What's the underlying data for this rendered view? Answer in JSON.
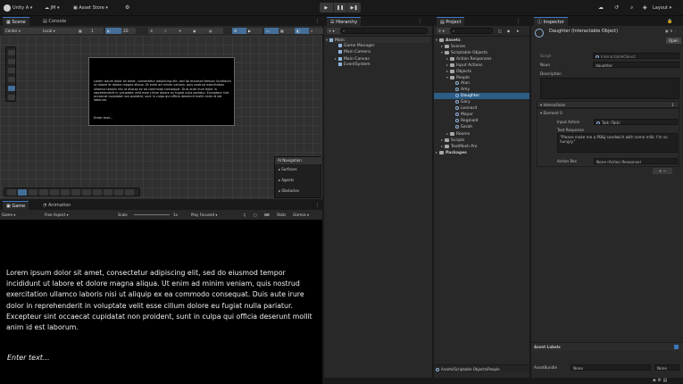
{
  "app": {
    "account": "Unity A",
    "cloud_menu": "JM",
    "asset_store": "Asset Store",
    "layout_label": "Layout"
  },
  "play_controls": [
    "▶",
    "❚❚",
    "▶❚"
  ],
  "scene": {
    "tabs": [
      "Scene",
      "Console"
    ],
    "toolbar": {
      "pivot_mode": "Center",
      "pivot_space": "Local",
      "snap_value": "1",
      "mode_2d": "2D"
    },
    "dialog": {
      "text": "Lorem ipsum dolor sit amet, consectetur adipiscing elit, sed do eiusmod tempor incididunt ut labore et dolore magna aliqua. Ut enim ad minim veniam, quis nostrud exercitation ullamco laboris nisi ut aliquip ex ea commodo consequat. Duis aute irure dolor in reprehenderit in voluptate velit esse cillum dolore eu fugiat nulla pariatur. Excepteur sint occaecat cupidatat non proident, sunt in culpa qui officia deserunt mollit anim id est laborum.",
      "enter": "Enter text..."
    },
    "ai_navigation": {
      "title": "AI Navigation",
      "items": [
        "Surfaces",
        "Agents",
        "Obstacles"
      ]
    }
  },
  "game": {
    "tabs": [
      "Game",
      "Animation"
    ],
    "toolbar": {
      "display": "Game",
      "aspect": "Free Aspect",
      "scale_label": "Scale",
      "scale_value": "1x",
      "play_mode": "Play Focused",
      "stats": "Stats",
      "gizmos": "Gizmos"
    },
    "text": "Lorem ipsum dolor sit amet, consectetur adipiscing elit, sed do eiusmod tempor incididunt ut labore et dolore magna aliqua. Ut enim ad minim veniam, quis nostrud exercitation ullamco laboris nisi ut aliquip ex ea commodo consequat. Duis aute irure dolor in reprehenderit in voluptate velit esse cillum dolore eu fugiat nulla pariatur. Excepteur sint occaecat cupidatat non proident, sunt in culpa qui officia deserunt mollit anim id est laborum.",
    "enter": "Enter text..."
  },
  "hierarchy": {
    "tab": "Hierarchy",
    "root": "Main",
    "items": [
      "Game Manager",
      "Main Camera",
      "Main Canvas",
      "EventSystem"
    ]
  },
  "project": {
    "tab": "Project",
    "tree": [
      {
        "label": "Assets",
        "icon": "folder"
      },
      {
        "label": "Scenes",
        "icon": "folder"
      },
      {
        "label": "Scriptable Objects",
        "icon": "folder"
      },
      {
        "label": "Action Responses",
        "icon": "folder"
      },
      {
        "label": "Input Actions",
        "icon": "folder"
      },
      {
        "label": "Objects",
        "icon": "folder"
      },
      {
        "label": "People",
        "icon": "folder"
      },
      {
        "label": "Alan",
        "icon": "so"
      },
      {
        "label": "Amy",
        "icon": "so"
      },
      {
        "label": "Daughter",
        "icon": "so"
      },
      {
        "label": "Gary",
        "icon": "so"
      },
      {
        "label": "Leonard",
        "icon": "so"
      },
      {
        "label": "Mayor",
        "icon": "so"
      },
      {
        "label": "Reginald",
        "icon": "so"
      },
      {
        "label": "Sarah",
        "icon": "so"
      },
      {
        "label": "Rooms",
        "icon": "folder"
      },
      {
        "label": "Scripts",
        "icon": "folder"
      },
      {
        "label": "TextMesh Pro",
        "icon": "folder"
      },
      {
        "label": "Packages",
        "icon": "folder"
      }
    ],
    "footer_path": "Assets/Scriptable Objects/People"
  },
  "inspector": {
    "tab": "Inspector",
    "title": "Daughter (Interactable Object)",
    "open_button": "Open",
    "script_label": "Script",
    "script_value": "InteractableObject",
    "noun_label": "Noun",
    "noun_value": "daughter",
    "description_label": "Description",
    "interactions_label": "Interactions",
    "interactions_count": "1",
    "element_label": "Element 0",
    "input_action_label": "Input Action",
    "input_action_value": "Talk (Talk)",
    "text_response_label": "Text Response",
    "text_response_value": "\"Please make me a PB&J sandwich with some milk. I'm so hungry.\"",
    "action_response_label": "Action Res",
    "action_response_value": "None (Action Response)",
    "asset_labels": "Asset Labels",
    "assetbundle_label": "AssetBundle",
    "assetbundle_value": "None",
    "variant_value": "None"
  }
}
